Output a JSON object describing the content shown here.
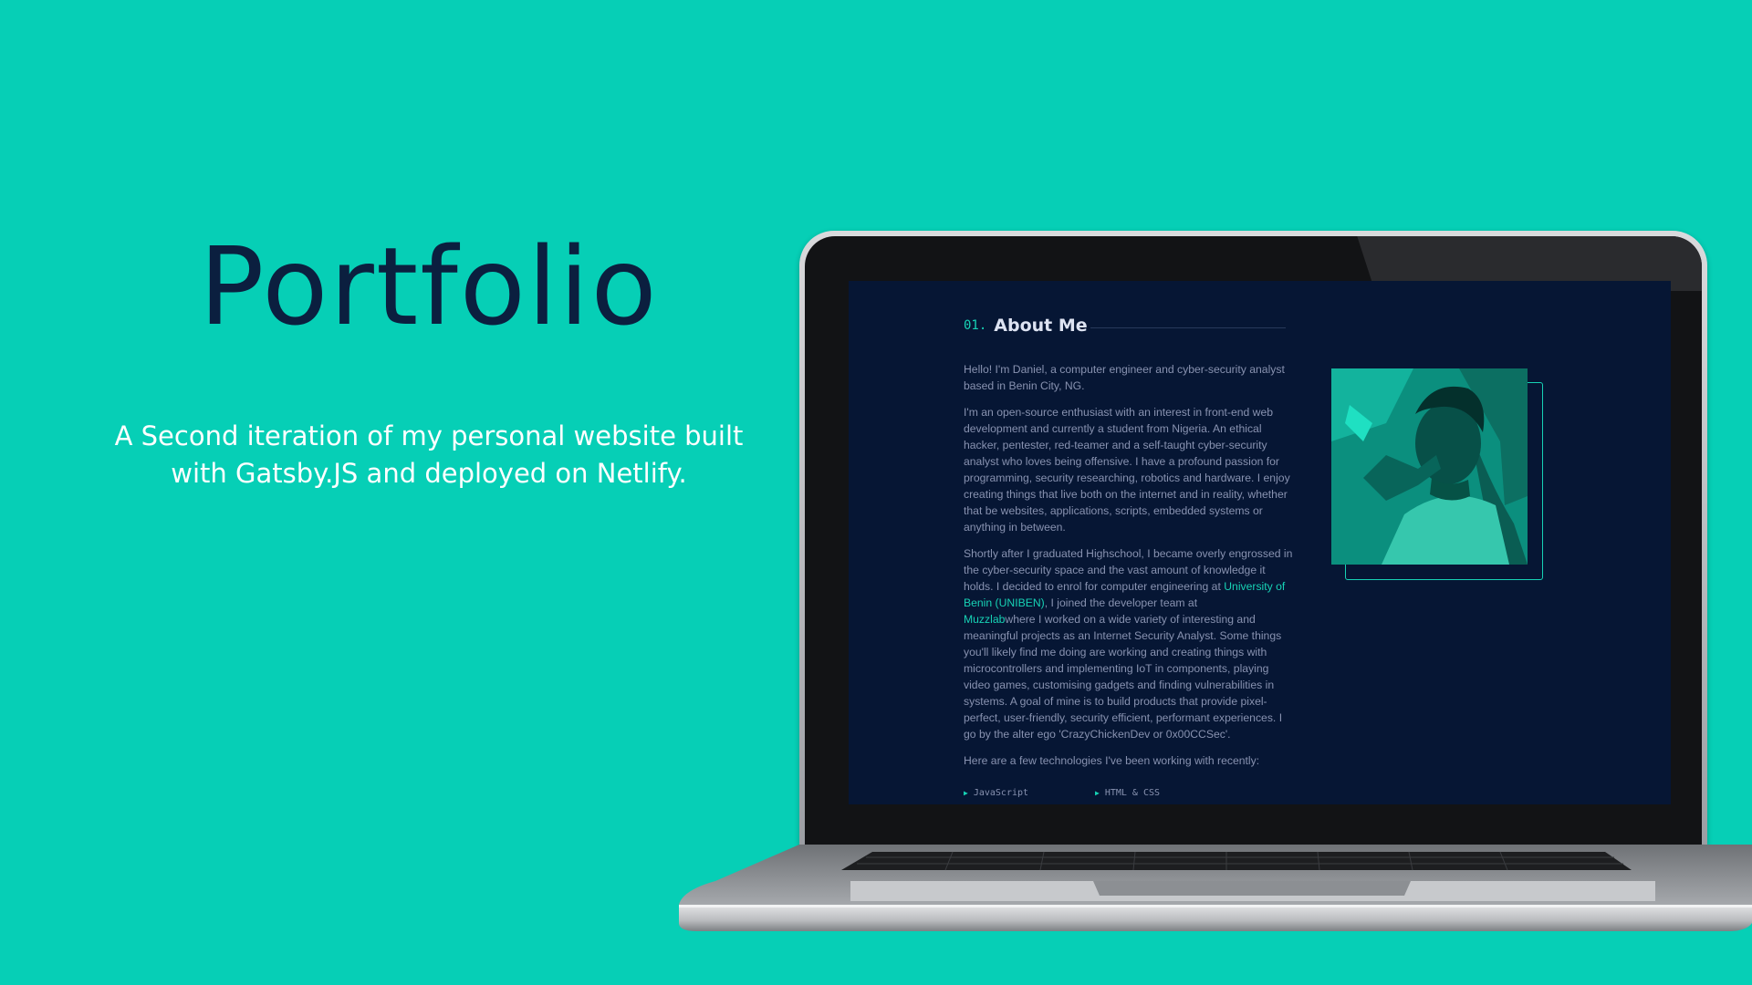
{
  "hero": {
    "title": "Portfolio",
    "subtitle_line1": "A Second iteration of my personal website built",
    "subtitle_line2": "with Gatsby.JS and deployed on Netlify."
  },
  "screen": {
    "section_number": "01.",
    "section_title": "About Me",
    "paragraphs": {
      "p1": "Hello! I'm Daniel, a computer engineer and cyber-security analyst based in Benin City, NG.",
      "p2": "I'm an open-source enthusiast with an interest in front-end web development and currently a student from Nigeria. An ethical hacker, pentester, red-teamer and a self-taught cyber-security analyst who loves being offensive. I have a profound passion for programming, security researching, robotics and hardware. I enjoy creating things that live both on the internet and in reality, whether that be websites, applications, scripts, embedded systems or anything in between.",
      "p3_start": "Shortly after I graduated Highschool, I became overly engrossed in the cyber-security space and the vast amount of knowledge it holds. I decided to enrol for computer engineering at ",
      "p3_link1": "University of Benin (UNIBEN)",
      "p3_mid": ", I joined the developer team at ",
      "p3_link2": "Muzzlab",
      "p3_end": "where I worked on a wide variety of interesting and meaningful projects as an Internet Security Analyst. Some things you'll likely find me doing are working and creating things with microcontrollers and implementing IoT in components, playing video games, customising gadgets and finding vulnerabilities in systems. A goal of mine is to build products that provide pixel-perfect, user-friendly, security efficient, performant experiences. I go by the alter ego 'CrazyChickenDev or 0x00CCSec'.",
      "p4": "Here are a few technologies I've been working with recently:"
    },
    "technologies": [
      "JavaScript",
      "HTML & CSS"
    ],
    "bullet_icon": "triangle-right-icon",
    "colors": {
      "accent": "#17d2b5",
      "screen_bg": "#061634",
      "text": "#8892b0",
      "heading": "#dde3f2"
    }
  },
  "colors": {
    "background": "#06cfb6",
    "title": "#0b1f3f",
    "subtitle": "#ffffff"
  }
}
